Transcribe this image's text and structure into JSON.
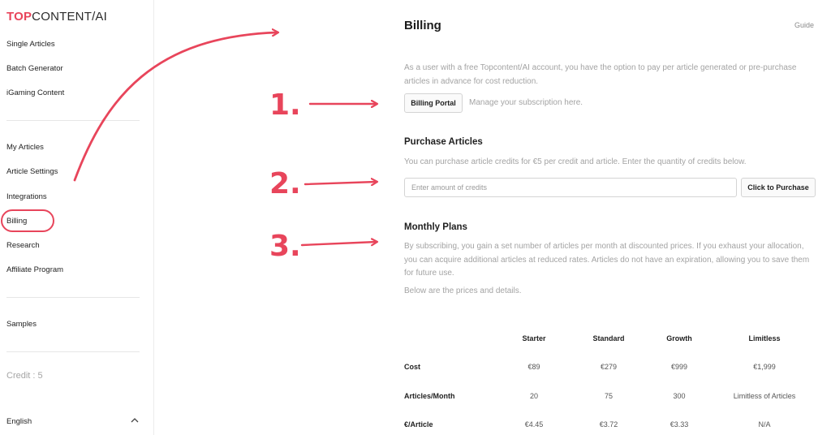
{
  "brand": {
    "logo_top": "TOP",
    "logo_rest": "CONTENT/AI"
  },
  "sidebar": {
    "items": [
      {
        "label": "Single Articles"
      },
      {
        "label": "Batch Generator"
      },
      {
        "label": "iGaming Content"
      },
      {
        "label": "My Articles"
      },
      {
        "label": "Article Settings"
      },
      {
        "label": "Integrations"
      },
      {
        "label": "Billing"
      },
      {
        "label": "Research"
      },
      {
        "label": "Affiliate Program"
      },
      {
        "label": "Samples"
      }
    ],
    "credit": "Credit : 5",
    "language": "English"
  },
  "main": {
    "title": "Billing",
    "guide": "Guide",
    "intro": "As a user with a free Topcontent/AI account, you have the option to pay per article generated or pre-purchase articles in advance for cost reduction.",
    "billing_portal_button": "Billing Portal",
    "billing_portal_hint": "Manage your subscription here.",
    "purchase": {
      "title": "Purchase Articles",
      "description": "You can purchase article credits for €5 per credit and article. Enter the quantity of credits below.",
      "input_placeholder": "Enter amount of credits",
      "button": "Click to Purchase"
    },
    "plans": {
      "title": "Monthly Plans",
      "description": "By subscribing, you gain a set number of articles per month at discounted prices. If you exhaust your allocation, you can acquire additional articles at reduced rates. Articles do not have an expiration, allowing you to save them for future use.",
      "note": "Below are the prices and details.",
      "columns": [
        "Starter",
        "Standard",
        "Growth",
        "Limitless"
      ],
      "rows": [
        {
          "label": "Cost",
          "values": [
            "€89",
            "€279",
            "€999",
            "€1,999"
          ]
        },
        {
          "label": "Articles/Month",
          "values": [
            "20",
            "75",
            "300",
            "Limitless of Articles"
          ]
        },
        {
          "label": "€/Article",
          "values": [
            "€4.45",
            "€3.72",
            "€3.33",
            "N/A"
          ]
        }
      ]
    }
  },
  "annotations": {
    "step1": "1.",
    "step2": "2.",
    "step3": "3.",
    "accent": "#e8455b"
  }
}
